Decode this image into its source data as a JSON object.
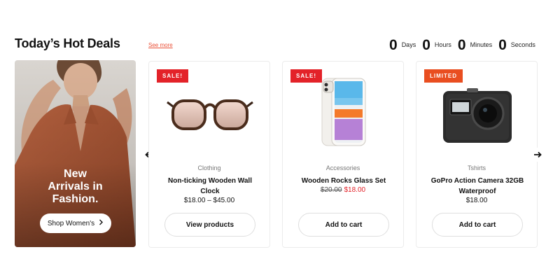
{
  "header": {
    "title": "Today’s Hot Deals",
    "see_more": "See more"
  },
  "countdown": {
    "days_value": "0",
    "days_label": "Days",
    "hours_value": "0",
    "hours_label": "Hours",
    "minutes_value": "0",
    "minutes_label": "Minutes",
    "seconds_value": "0",
    "seconds_label": "Seconds"
  },
  "banner": {
    "line1": "New",
    "line2": "Arrivals in",
    "line3": "Fashion.",
    "button_label": "Shop Women's",
    "button_icon": "chevron-right-icon"
  },
  "products": [
    {
      "badge": "SALE!",
      "category": "Clothing",
      "name": "Non-ticking Wooden Wall Clock",
      "price": "$18.00 – $45.00",
      "button": "View products",
      "image_icon": "sunglasses-icon"
    },
    {
      "badge": "SALE!",
      "category": "Accessories",
      "name": "Wooden Rocks Glass Set",
      "old_price": "$20.00",
      "new_price": "$18.00",
      "button": "Add to cart",
      "image_icon": "smartphone-icon"
    },
    {
      "badge": "LIMITED",
      "category": "Tshirts",
      "name": "GoPro Action Camera 32GB Waterproof",
      "price": "$18.00",
      "button": "Add to cart",
      "image_icon": "action-camera-icon"
    }
  ],
  "carousel": {
    "prev_icon": "arrow-left-icon",
    "next_icon": "arrow-right-icon"
  },
  "colors": {
    "accent": "#e94e35",
    "sale_badge": "#e32229",
    "limited_badge": "#e94e20",
    "sale_price": "#e32229"
  }
}
